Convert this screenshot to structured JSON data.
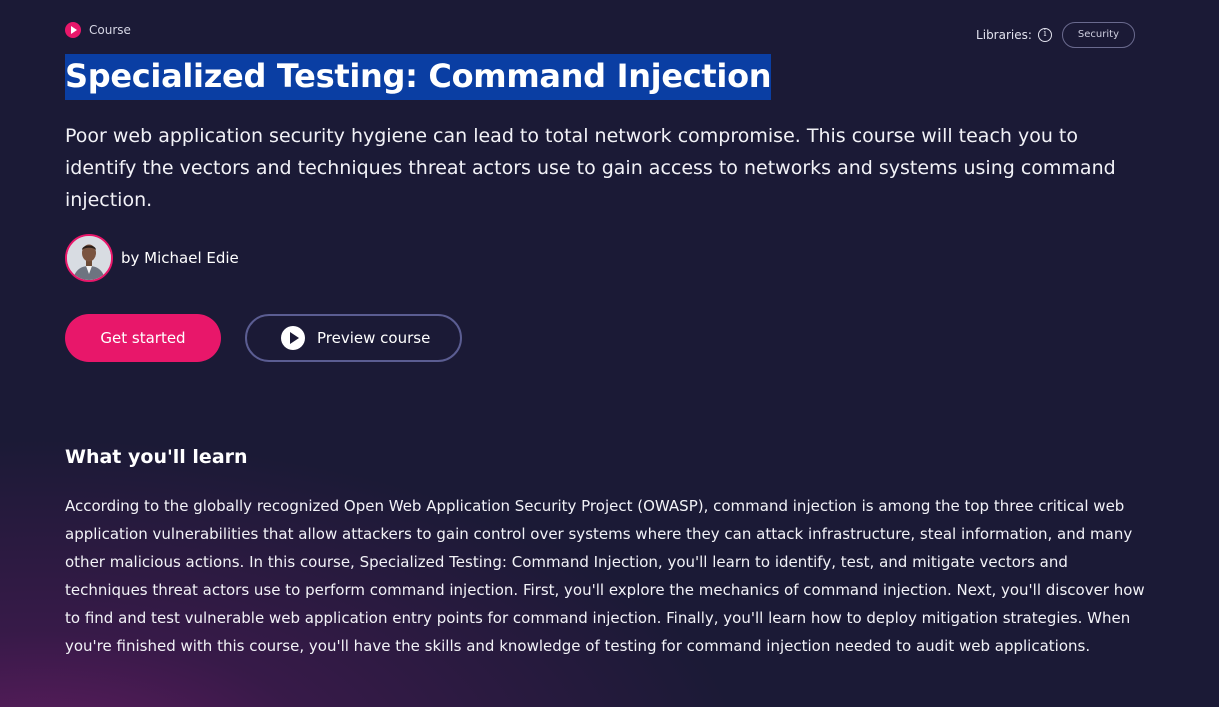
{
  "header": {
    "type_label": "Course",
    "type_icon": "play-circle-icon",
    "libraries_label": "Libraries:",
    "libraries_icon": "info-icon",
    "library_tag": "Security"
  },
  "course": {
    "title": "Specialized Testing: Command Injection",
    "description": "Poor web application security hygiene can lead to total network compromise. This course will teach you to identify the vectors and techniques threat actors use to gain access to networks and systems using command injection.",
    "author": "by Michael Edie"
  },
  "actions": {
    "get_started": "Get started",
    "preview": "Preview course"
  },
  "learn": {
    "heading": "What you'll learn",
    "body": "According to the globally recognized Open Web Application Security Project (OWASP), command injection is among the top three critical web application vulnerabilities that allow attackers to gain control over systems where they can attack infrastructure, steal information, and many other malicious actions. In this course, Specialized Testing: Command Injection, you'll learn to identify, test, and mitigate vectors and techniques threat actors use to perform command injection. First, you'll explore the mechanics of command injection. Next, you'll discover how to find and test vulnerable web application entry points for command injection. Finally, you'll learn how to deploy mitigation strategies. When you're finished with this course, you'll have the skills and knowledge of testing for command injection needed to audit web applications."
  },
  "colors": {
    "background": "#1b1a36",
    "accent": "#e8176a",
    "title_highlight": "#0a3ea3",
    "secondary_border": "#5b5d92"
  }
}
